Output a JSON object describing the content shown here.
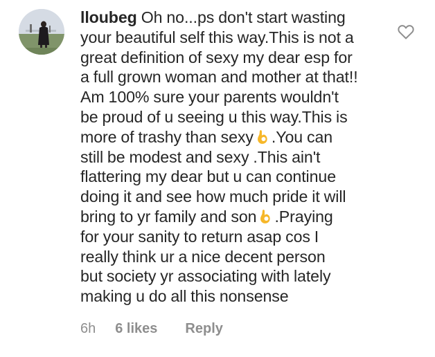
{
  "comment": {
    "username": "lloubeg",
    "lines": [
      "Oh no...ps don't start wasting",
      "your beautiful self this way.This is not a",
      "great definition of sexy my dear esp for",
      "a full grown woman and mother at that!!",
      "Am 100% sure your parents wouldn't",
      "be proud of u seeing u this way.This is",
      "more of trashy than sexy",
      ".You can",
      "still be modest and sexy .This ain't",
      "flattering my dear but u can continue",
      "doing it and see how much pride it will",
      "bring to yr family and son",
      ".Praying",
      "for your sanity to return asap cos I",
      "really think ur a nice decent person",
      "but society yr associating with lately",
      "making u do all this nonsense"
    ],
    "emoji_icon": "ok-hand-emoji-icon",
    "like_icon": "heart-outline-icon"
  },
  "meta": {
    "time": "6h",
    "likes": "6 likes",
    "reply": "Reply"
  },
  "colors": {
    "text": "#262626",
    "meta": "#8e8e8e",
    "heart": "#8e8e8e",
    "emoji": "#f6b729"
  }
}
